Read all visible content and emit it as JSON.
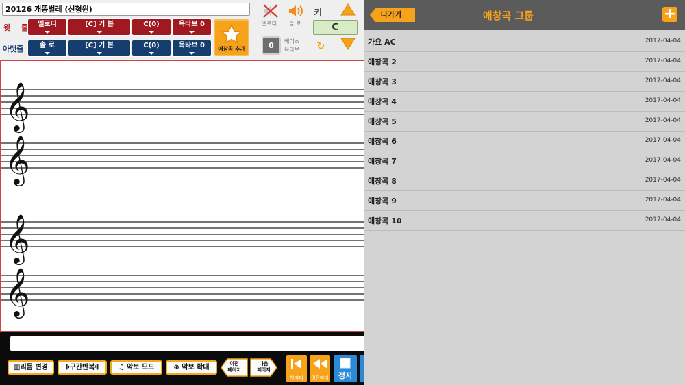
{
  "song_title": "20126  개똥벌레 (신형원)",
  "upper_row_label": "윗 줄",
  "lower_row_label": "아랫줄",
  "upper_tabs": [
    {
      "label": "멜로디"
    },
    {
      "label": "[C] 기  본"
    },
    {
      "label": "C(0)"
    },
    {
      "label": "옥타브 0"
    }
  ],
  "lower_tabs": [
    {
      "label": "솔  로"
    },
    {
      "label": "[C] 기  본"
    },
    {
      "label": "C(0)"
    },
    {
      "label": "옥타브 0"
    }
  ],
  "add_favorite": {
    "label": "애창곡 추가",
    "icon": "star-icon"
  },
  "melody_toggle": {
    "label": "멜로디",
    "icon": "speaker-muted-icon"
  },
  "solo_toggle": {
    "label": "솔  로",
    "icon": "speaker-icon"
  },
  "key": {
    "label": "키",
    "value": "C"
  },
  "bass_octave": {
    "value": "0",
    "label1": "베이스",
    "label2": "옥타브"
  },
  "controls": {
    "rhythm_change": "리듬 변경",
    "section_repeat": "구간반복",
    "score_mode": "악보 모드",
    "score_zoom": "악보 확대",
    "prev_page": [
      "이전",
      "페이지"
    ],
    "next_page": [
      "다음",
      "페이지"
    ],
    "first_measure": "첫마디",
    "prev_measure": "이전마디",
    "stop": "정지"
  },
  "right_panel": {
    "back_label": "나가기",
    "title": "애창곡 그룹",
    "add_icon": "plus-icon",
    "groups": [
      {
        "name": "가요 AC",
        "date": "2017-04-04"
      },
      {
        "name": "애창곡 2",
        "date": "2017-04-04"
      },
      {
        "name": "애창곡 3",
        "date": "2017-04-04"
      },
      {
        "name": "애창곡 4",
        "date": "2017-04-04"
      },
      {
        "name": "애창곡 5",
        "date": "2017-04-04"
      },
      {
        "name": "애창곡 6",
        "date": "2017-04-04"
      },
      {
        "name": "애창곡 7",
        "date": "2017-04-04"
      },
      {
        "name": "애창곡 8",
        "date": "2017-04-04"
      },
      {
        "name": "애창곡 9",
        "date": "2017-04-04"
      },
      {
        "name": "애창곡 10",
        "date": "2017-04-04"
      }
    ]
  },
  "colors": {
    "accent": "#f6a21b",
    "upper_tab": "#a01820",
    "lower_tab": "#153e6e",
    "header": "#5c5b5b",
    "list_bg": "#d3d3d3"
  }
}
